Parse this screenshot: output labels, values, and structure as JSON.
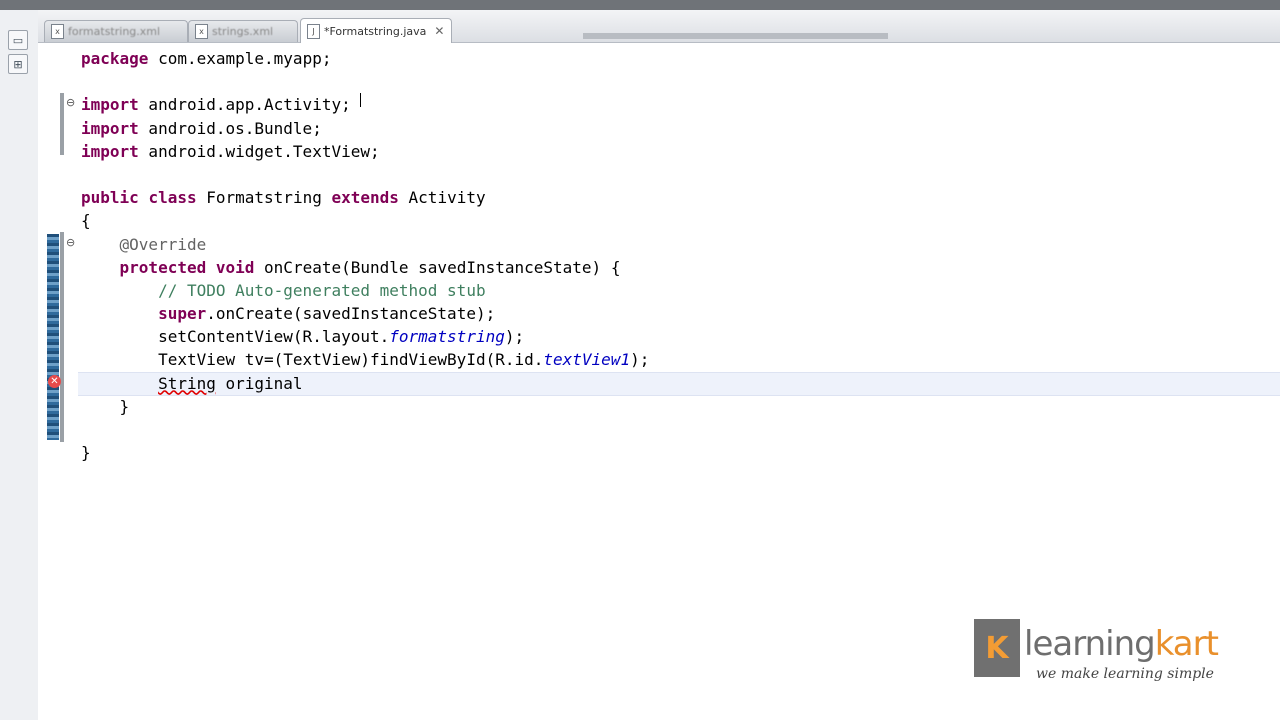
{
  "tabs": [
    {
      "label": "formatstring.xml",
      "active": false
    },
    {
      "label": "strings.xml",
      "active": false
    },
    {
      "label": "*Formatstring.java",
      "active": true
    }
  ],
  "code": [
    {
      "tokens": [
        {
          "t": "package com.example.myapp;",
          "c": "kw"
        }
      ]
    },
    {
      "tokens": []
    },
    {
      "tokens": [
        {
          "t": "import",
          "c": "kw"
        },
        {
          "t": " android.app.Activity;"
        }
      ]
    },
    {
      "tokens": [
        {
          "t": "import",
          "c": "kw"
        },
        {
          "t": " android.os.Bundle;"
        }
      ]
    },
    {
      "tokens": [
        {
          "t": "import",
          "c": "kw"
        },
        {
          "t": " android.widget.TextView;"
        }
      ]
    },
    {
      "tokens": []
    },
    {
      "tokens": [
        {
          "t": "public",
          "c": "kw"
        },
        {
          "t": " "
        },
        {
          "t": "class",
          "c": "kw"
        },
        {
          "t": " Formatstring "
        },
        {
          "t": "extends",
          "c": "kw"
        },
        {
          "t": " Activity"
        }
      ]
    },
    {
      "tokens": [
        {
          "t": "{"
        }
      ]
    },
    {
      "tokens": [
        {
          "t": "    "
        },
        {
          "t": "@Override",
          "c": "ann"
        }
      ]
    },
    {
      "tokens": [
        {
          "t": "    "
        },
        {
          "t": "protected",
          "c": "kw"
        },
        {
          "t": " "
        },
        {
          "t": "void",
          "c": "kw"
        },
        {
          "t": " onCreate(Bundle savedInstanceState) {"
        }
      ]
    },
    {
      "tokens": [
        {
          "t": "        "
        },
        {
          "t": "// TODO Auto-generated method stub",
          "c": "cmt"
        }
      ]
    },
    {
      "tokens": [
        {
          "t": "        "
        },
        {
          "t": "super",
          "c": "kw"
        },
        {
          "t": ".onCreate(savedInstanceState);"
        }
      ]
    },
    {
      "tokens": [
        {
          "t": "        setContentView(R.layout."
        },
        {
          "t": "formatstring",
          "c": "it"
        },
        {
          "t": ");"
        }
      ]
    },
    {
      "tokens": [
        {
          "t": "        TextView tv=(TextView)findViewById(R.id."
        },
        {
          "t": "textView1",
          "c": "it"
        },
        {
          "t": ");"
        }
      ]
    },
    {
      "tokens": [
        {
          "t": "        "
        },
        {
          "t": "String",
          "c": "err"
        },
        {
          "t": " original"
        }
      ]
    },
    {
      "tokens": [
        {
          "t": "    }"
        }
      ]
    },
    {
      "tokens": []
    },
    {
      "tokens": [
        {
          "t": "}"
        }
      ]
    }
  ],
  "watermark": {
    "name_part1": "learning",
    "name_part2": "kart",
    "tagline": "we make learning simple"
  },
  "colors": {
    "keyword": "#7f0055",
    "comment": "#3f7f5f",
    "annotation": "#646464",
    "field_italic": "#0000c0",
    "error": "#e00000"
  },
  "icons": {
    "tab_file": "java-file-icon",
    "tab_close": "close-icon",
    "fold": "fold-minus-icon",
    "error": "error-marker-icon"
  }
}
